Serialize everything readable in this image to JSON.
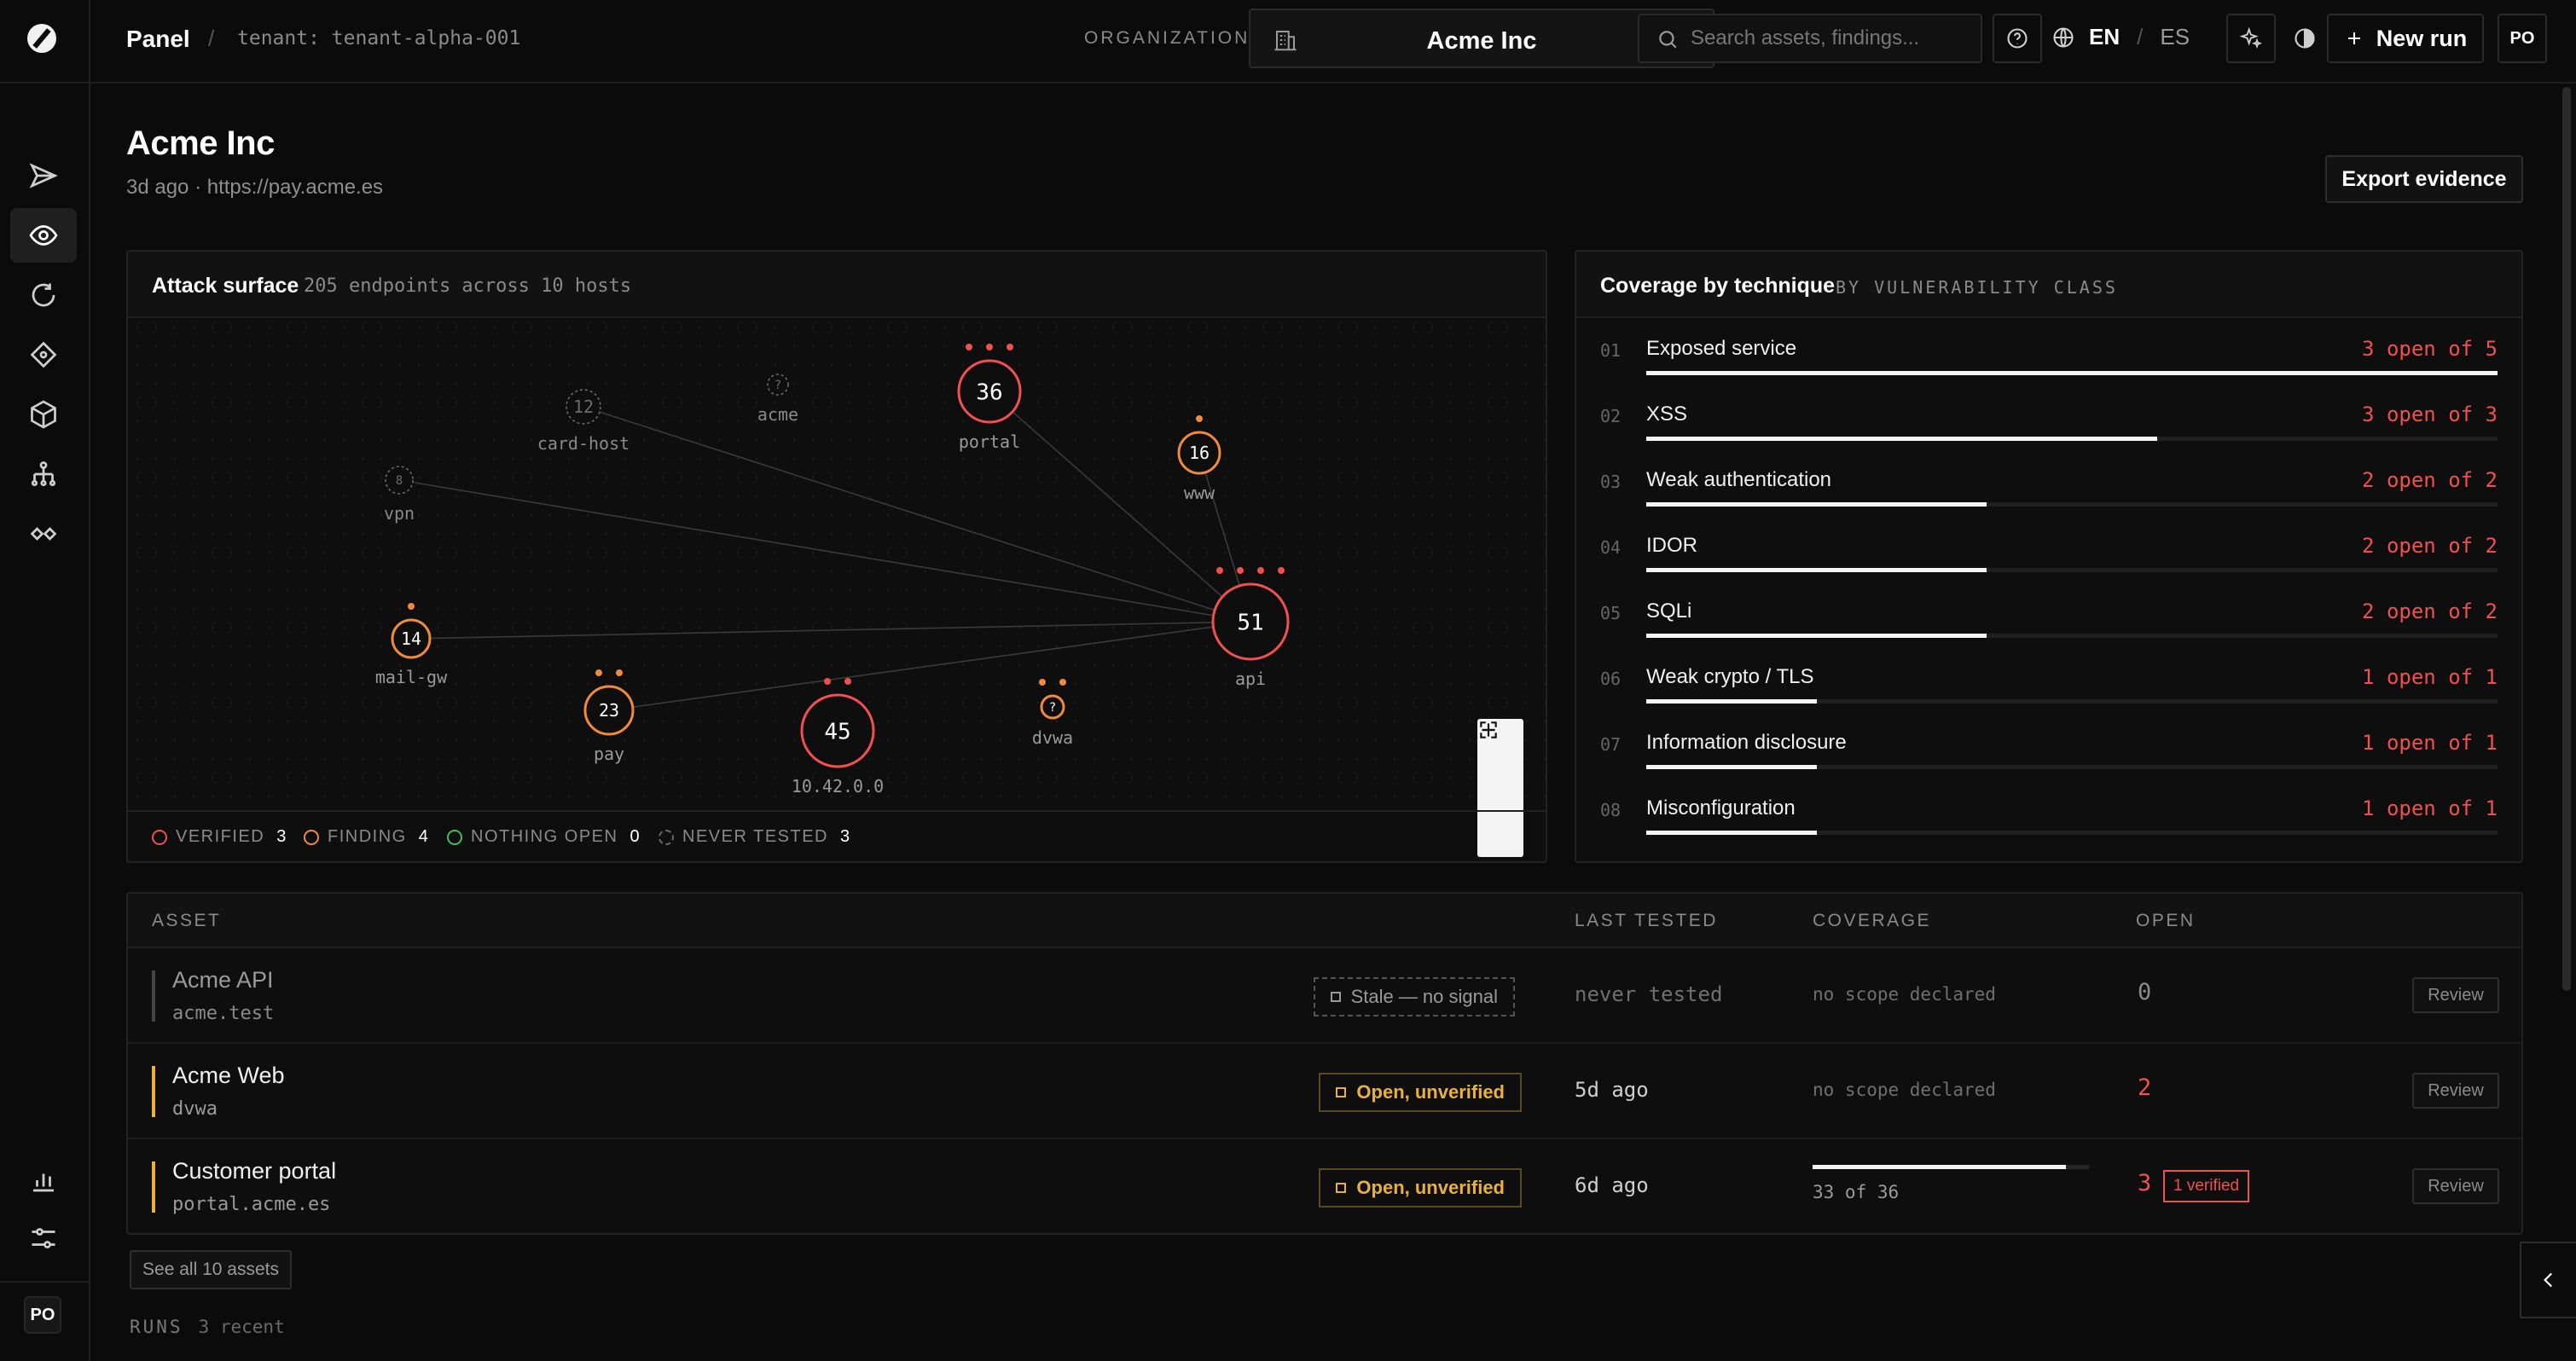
{
  "header": {
    "brand": "Panel",
    "breadcrumb_sep": "/",
    "tenant": "tenant: tenant-alpha-001",
    "org_label": "ORGANIZATION",
    "org_value": "Acme Inc",
    "search_placeholder": "Search assets, findings...",
    "lang_active": "EN",
    "lang_sep": "/",
    "lang_other": "ES",
    "new_run": "New run",
    "avatar": "PO"
  },
  "rail": {
    "icons": [
      "send-icon",
      "eye-icon",
      "refresh-icon",
      "diamond-icon",
      "cube-icon",
      "hierarchy-icon",
      "infinity-icon",
      "bar-chart-icon",
      "sliders-icon"
    ],
    "avatar": "PO"
  },
  "page": {
    "title": "Acme Inc",
    "subtitle": "3d ago · https://pay.acme.es",
    "export": "Export evidence"
  },
  "surface": {
    "title": "Attack surface",
    "subtitle": "205 endpoints across 10 hosts",
    "nodes": [
      {
        "label": "acme",
        "count": "?",
        "kind": "never"
      },
      {
        "label": "card-host",
        "count": "12",
        "kind": "never"
      },
      {
        "label": "vpn",
        "count": "8",
        "kind": "never"
      },
      {
        "label": "portal",
        "count": "36",
        "kind": "verified"
      },
      {
        "label": "www",
        "count": "16",
        "kind": "finding"
      },
      {
        "label": "api",
        "count": "51",
        "kind": "verified"
      },
      {
        "label": "mail-gw",
        "count": "14",
        "kind": "finding"
      },
      {
        "label": "pay",
        "count": "23",
        "kind": "finding"
      },
      {
        "label": "10.42.0.0",
        "count": "45",
        "kind": "verified"
      },
      {
        "label": "dvwa",
        "count": "?",
        "kind": "finding"
      }
    ],
    "legend": [
      {
        "label": "VERIFIED",
        "count": "3",
        "color": "#f05050"
      },
      {
        "label": "FINDING",
        "count": "4",
        "color": "#f08a3c"
      },
      {
        "label": "NOTHING OPEN",
        "count": "0",
        "color": "#3fbf5f"
      },
      {
        "label": "NEVER TESTED",
        "count": "3",
        "color": "#6a6a6a"
      }
    ]
  },
  "coverage": {
    "title": "Coverage by technique",
    "subtitle": "BY VULNERABILITY CLASS",
    "rows": [
      {
        "n": "01",
        "label": "Exposed service",
        "count": "3 open of 5",
        "fill": 1.0
      },
      {
        "n": "02",
        "label": "XSS",
        "count": "3 open of 3",
        "fill": 0.6
      },
      {
        "n": "03",
        "label": "Weak authentication",
        "count": "2 open of 2",
        "fill": 0.4
      },
      {
        "n": "04",
        "label": "IDOR",
        "count": "2 open of 2",
        "fill": 0.4
      },
      {
        "n": "05",
        "label": "SQLi",
        "count": "2 open of 2",
        "fill": 0.4
      },
      {
        "n": "06",
        "label": "Weak crypto / TLS",
        "count": "1 open of 1",
        "fill": 0.2
      },
      {
        "n": "07",
        "label": "Information disclosure",
        "count": "1 open of 1",
        "fill": 0.2
      },
      {
        "n": "08",
        "label": "Misconfiguration",
        "count": "1 open of 1",
        "fill": 0.2
      }
    ]
  },
  "table": {
    "headers": {
      "asset": "ASSET",
      "last_tested": "LAST TESTED",
      "coverage": "COVERAGE",
      "open": "OPEN"
    },
    "rows": [
      {
        "name": "Acme API",
        "host": "acme.test",
        "status": "Stale — no signal",
        "last_tested": "never tested",
        "coverage": "no scope declared",
        "open": "0",
        "review": "Review"
      },
      {
        "name": "Acme Web",
        "host": "dvwa",
        "status": "Open, unverified",
        "last_tested": "5d ago",
        "coverage": "no scope declared",
        "open": "2",
        "review": "Review"
      },
      {
        "name": "Customer portal",
        "host": "portal.acme.es",
        "status": "Open, unverified",
        "last_tested": "6d ago",
        "coverage": "33 of 36",
        "coverage_fill": 0.917,
        "open": "3",
        "badge": "1 verified",
        "review": "Review"
      }
    ],
    "see_all": "See all 10 assets"
  },
  "runs": {
    "label": "RUNS",
    "sub": "3 recent"
  },
  "colors": {
    "verified": "#f05050",
    "finding": "#f08a3c",
    "nothing": "#3fbf5f",
    "never": "#6a6a6a",
    "stale_accent": "#444444",
    "open_accent": "#e9b13a"
  }
}
